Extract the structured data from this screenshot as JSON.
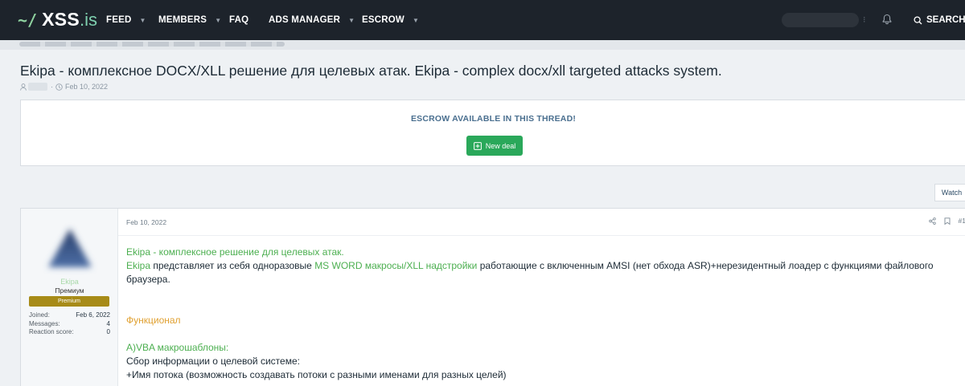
{
  "nav": {
    "logo_tilde": "~/",
    "logo_main": "XSS",
    "logo_suffix": ".is",
    "items": [
      {
        "label": "FEED",
        "has_caret": true
      },
      {
        "label": "MEMBERS",
        "has_caret": true
      },
      {
        "label": "FAQ",
        "has_caret": false
      },
      {
        "label": "ADS MANAGER",
        "has_caret": true
      },
      {
        "label": "ESCROW",
        "has_caret": true
      }
    ],
    "search_label": "SEARCH",
    "icons": [
      "bell-icon",
      "search-icon"
    ]
  },
  "thread": {
    "title": "Ekipa - комплексное DOCX/XLL решение для целевых атак. Ekipa - complex docx/xll targeted attacks system.",
    "date": "Feb 10, 2022",
    "separator": "·"
  },
  "escrow": {
    "title": "ESCROW AVAILABLE IN THIS THREAD!",
    "button_label": "New deal"
  },
  "watch_label": "Watch",
  "post": {
    "author_name": "Ekipa",
    "author_rank": "Премиум",
    "badge": "Premium",
    "stats": [
      {
        "label": "Joined:",
        "value": "Feb 6, 2022"
      },
      {
        "label": "Messages:",
        "value": "4"
      },
      {
        "label": "Reaction score:",
        "value": "0"
      }
    ],
    "date": "Feb 10, 2022",
    "number": "#1",
    "body": {
      "line1": "Ekipa - комплексное решение для целевых атак.",
      "line2_a": "Ekipa",
      "line2_b": " представляет из себя одноразовые ",
      "line2_c": "MS WORD макросы/XLL надстройки",
      "line2_d": " работающие с включенным AMSI (нет обхода ASR)+нерезидентный лоадер с функциями файлового",
      "line3": "браузера.",
      "heading": "Функционал",
      "section_title": "A)VBA макрошаблоны:",
      "line4": "Сбор информации о целевой системе:",
      "line5": "+Имя потока (возможность создавать потоки с разными именами для разных целей)"
    }
  },
  "colors": {
    "nav_bg": "#1d232b",
    "accent_green": "#2aa85a",
    "link_green": "#4caf50",
    "heading_orange": "#e0a030",
    "escrow_title": "#4a6f8f",
    "premium_badge": "#a78b18"
  }
}
